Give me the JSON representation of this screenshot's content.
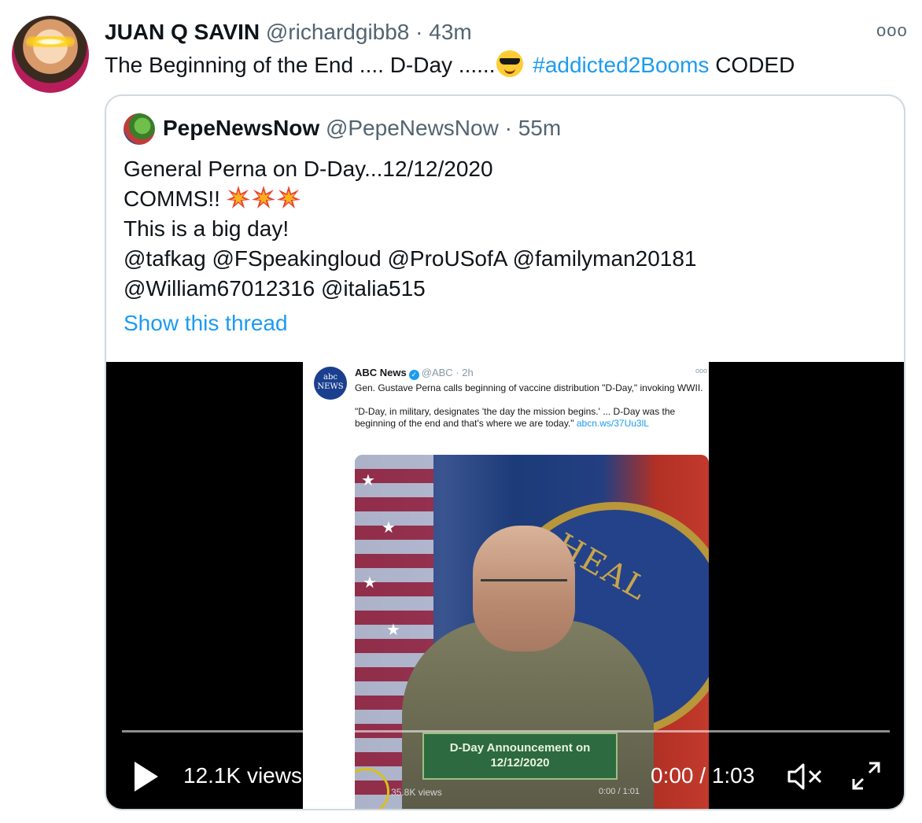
{
  "tweet": {
    "author_name": "JUAN Q SAVIN",
    "handle": "@richardgibb8",
    "separator": "·",
    "time": "43m",
    "text_before": "The Beginning of the End .... D-Day ......",
    "emoji": "smiling-face-with-sunglasses",
    "hashtag": "#addicted2Booms",
    "text_after": "CODED",
    "more_label": "ooo"
  },
  "quote": {
    "author_name": "PepeNewsNow",
    "handle": "@PepeNewsNow",
    "separator": "·",
    "time": "55m",
    "lines": [
      "General Perna on D-Day...12/12/2020",
      "COMMS!!",
      "This is a big day!",
      "@tafkag @FSpeakingloud @ProUSofA @familyman20181",
      "@William67012316 @italia515"
    ],
    "emoji": "collision",
    "show_thread": "Show this thread"
  },
  "embedded_tweet": {
    "logo_top": "abc",
    "logo_bottom": "NEWS",
    "author_name": "ABC News",
    "handle": "@ABC",
    "separator": "·",
    "time": "2h",
    "more_label": "ooo",
    "paragraph1": "Gen. Gustave Perna calls beginning of vaccine distribution \"D-Day,\" invoking WWII.",
    "paragraph2": "\"D-Day, in military, designates 'the day the mission begins.' ... D-Day was the beginning of the end and that's where we are today.\"",
    "link": "abcn.ws/37Uu3lL",
    "seal_text": "HEAL",
    "banner": "D-Day Announcement on 12/12/2020",
    "views": "35.8K views",
    "time_display": "0:00 / 1:01"
  },
  "video": {
    "views": "12.1K views",
    "time_display": "0:00 / 1:03",
    "progress": 0
  },
  "colors": {
    "accent": "#1d9bf0",
    "border": "#cfd9de",
    "muted_text": "#536471"
  }
}
